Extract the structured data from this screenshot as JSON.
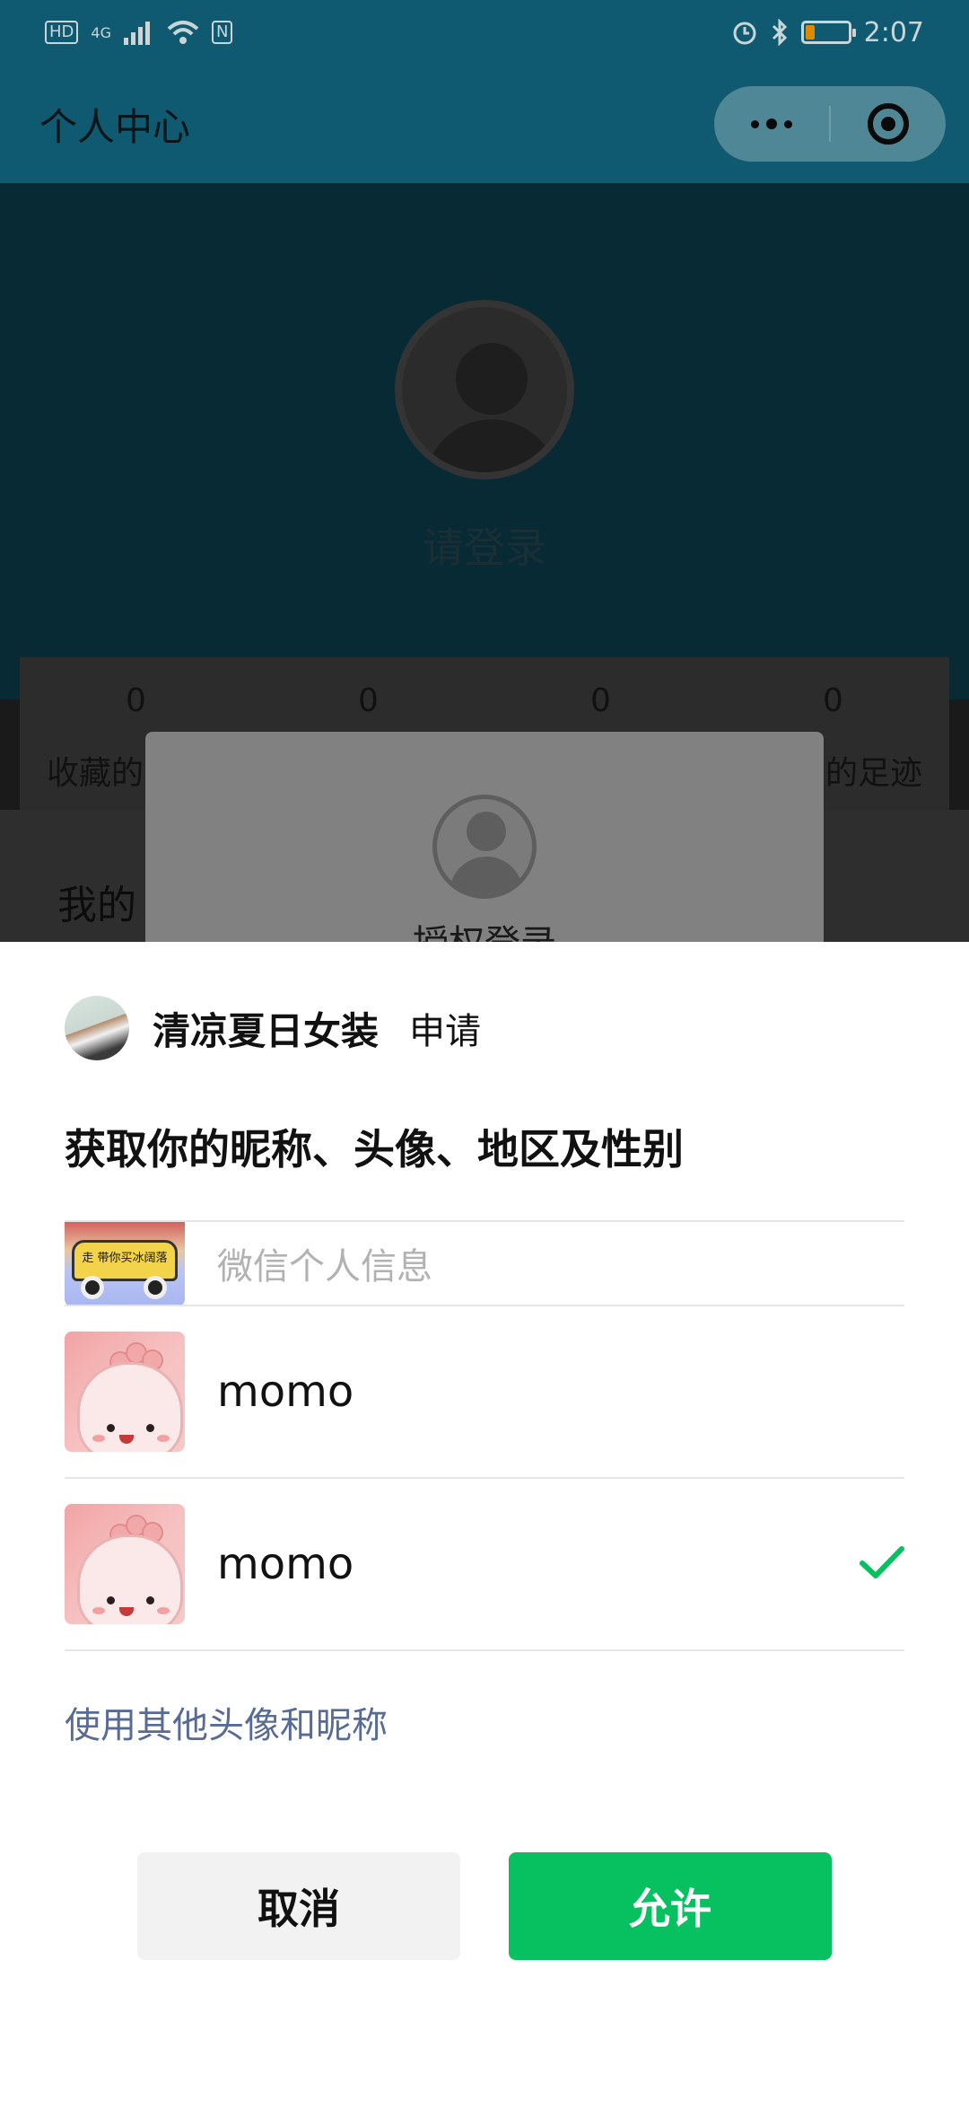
{
  "status_bar": {
    "network_badge": "HD",
    "network_type": "4G",
    "nfc": "N",
    "time": "2:07"
  },
  "nav": {
    "title": "个人中心"
  },
  "profile": {
    "login_prompt": "请登录",
    "stats": [
      "0",
      "0",
      "0",
      "0"
    ],
    "stat_label_left": "收藏的",
    "stat_label_right": "的足迹",
    "section_title": "我的"
  },
  "auth_card": {
    "title": "授权登录"
  },
  "sheet": {
    "app_name": "清凉夏日女装",
    "request_word": "申请",
    "request_title": "获取你的昵称、头像、地区及性别",
    "items": [
      {
        "label": "微信个人信息",
        "thumb_text": "走 带你买冰阔落",
        "selected": false
      },
      {
        "label": "momo",
        "selected": false
      },
      {
        "label": "momo",
        "selected": true
      }
    ],
    "other_link": "使用其他头像和昵称",
    "cancel_label": "取消",
    "allow_label": "允许"
  },
  "colors": {
    "status_nav_bg": "#0f5a70",
    "allow_green": "#07c160",
    "link_blue": "#576b95",
    "check_green": "#07c160"
  },
  "icons": [
    "hd-badge-icon",
    "signal-icon",
    "wifi-icon",
    "nfc-icon",
    "alarm-icon",
    "bluetooth-icon",
    "battery-icon",
    "more-dots-icon",
    "close-target-icon",
    "avatar-placeholder-icon",
    "checkmark-icon"
  ]
}
